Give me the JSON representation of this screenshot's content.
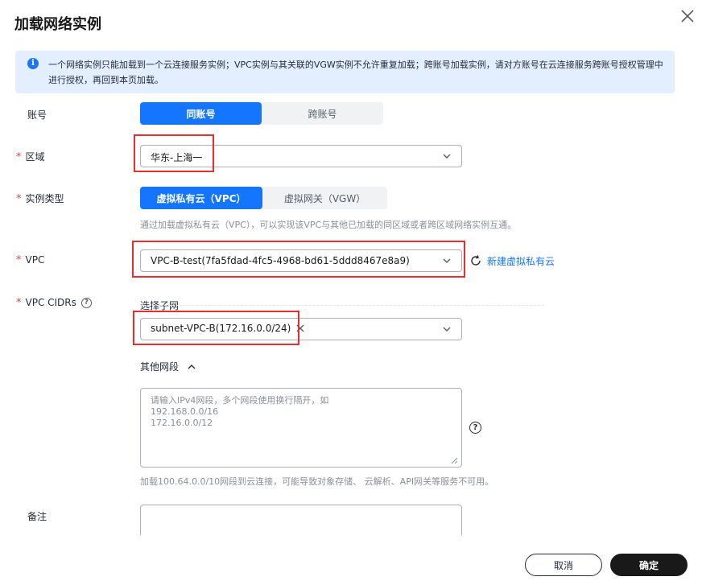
{
  "dialog": {
    "title": "加载网络实例"
  },
  "notice": {
    "text": "一个网络实例只能加载到一个云连接服务实例；VPC实例与其关联的VGW实例不允许重复加载；跨账号加载实例，请对方账号在云连接服务跨账号授权管理中进行授权，再回到本页加载。"
  },
  "form": {
    "account": {
      "label": "账号",
      "options": [
        "同账号",
        "跨账号"
      ],
      "selected": "同账号"
    },
    "region": {
      "label": "区域",
      "value": "华东-上海一"
    },
    "instance_type": {
      "label": "实例类型",
      "options": [
        "虚拟私有云（VPC）",
        "虚拟网关（VGW）"
      ],
      "selected": "虚拟私有云（VPC）",
      "hint": "通过加载虚拟私有云（VPC），可以实现该VPC与其他已加载的同区域或者跨区域网络实例互通。"
    },
    "vpc": {
      "label": "VPC",
      "value": "VPC-B-test(7fa5fdad-4fc5-4968-bd61-5ddd8467e8a9)",
      "create_link": "新建虚拟私有云"
    },
    "vpc_cidrs": {
      "label": "VPC CIDRs",
      "help": "?",
      "subnet_title": "选择子网",
      "subnet_tag": "subnet-VPC-B(172.16.0.0/24)",
      "other_title": "其他网段",
      "textarea_placeholder": "请输入IPv4网段，多个网段使用换行隔开，如\n192.168.0.0/16\n172.16.0.0/12",
      "textarea_help": "?",
      "hint": "加载100.64.0.0/10网段到云连接，可能导致对象存储、 云解析、API网关等服务不可用。"
    },
    "remark": {
      "label": "备注",
      "value": ""
    }
  },
  "footer": {
    "cancel": "取消",
    "ok": "确定"
  },
  "colors": {
    "primary": "#1476ff",
    "highlight": "#e52e2e",
    "notice_bg": "#e3effe"
  }
}
